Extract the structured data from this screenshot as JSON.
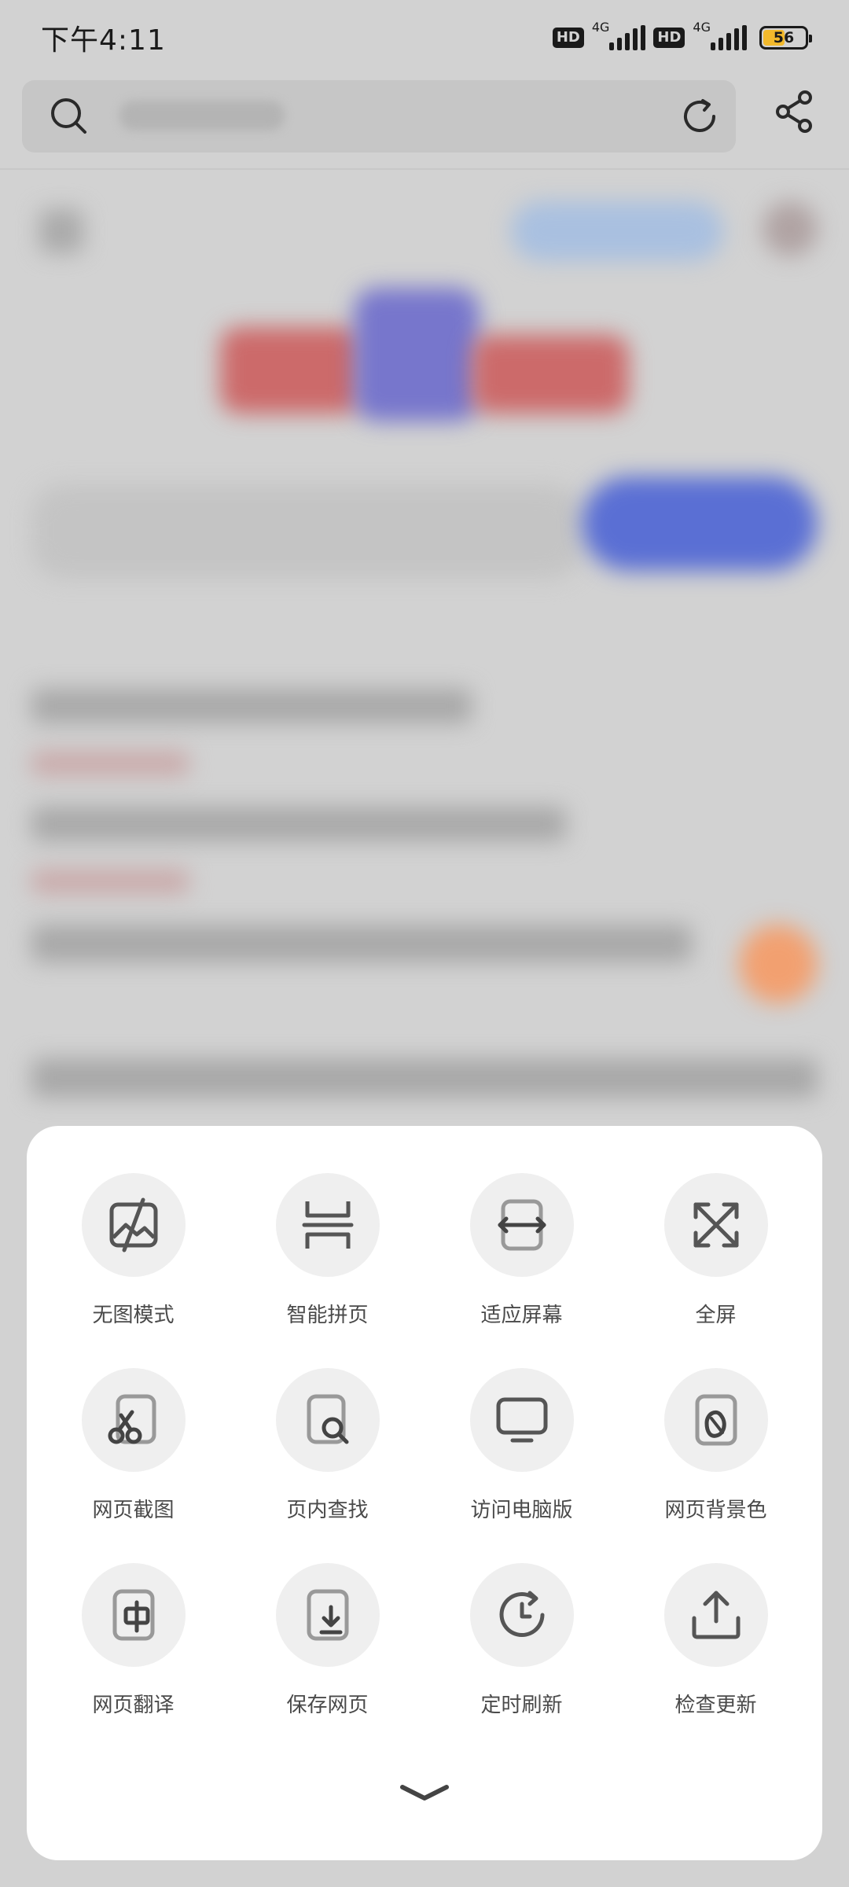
{
  "status_bar": {
    "time": "下午4:11",
    "hd_badge": "HD",
    "network": "4G",
    "battery": "56",
    "battery_level_percent": 56
  },
  "sheet": {
    "items": [
      {
        "label": "无图模式",
        "icon": "no-image-icon"
      },
      {
        "label": "智能拼页",
        "icon": "smart-page-join-icon"
      },
      {
        "label": "适应屏幕",
        "icon": "fit-screen-icon"
      },
      {
        "label": "全屏",
        "icon": "fullscreen-icon"
      },
      {
        "label": "网页截图",
        "icon": "screenshot-scissors-icon"
      },
      {
        "label": "页内查找",
        "icon": "find-in-page-icon"
      },
      {
        "label": "访问电脑版",
        "icon": "desktop-version-icon"
      },
      {
        "label": "网页背景色",
        "icon": "background-color-icon"
      },
      {
        "label": "网页翻译",
        "icon": "translate-icon"
      },
      {
        "label": "保存网页",
        "icon": "save-page-icon"
      },
      {
        "label": "定时刷新",
        "icon": "timed-refresh-icon"
      },
      {
        "label": "检查更新",
        "icon": "check-update-icon"
      }
    ]
  },
  "colors": {
    "overlay_background": "#d2d2d2",
    "sheet_background": "#ffffff",
    "icon_circle": "#efefef",
    "icon_stroke": "#555555",
    "label_text": "#4a4a4a"
  }
}
